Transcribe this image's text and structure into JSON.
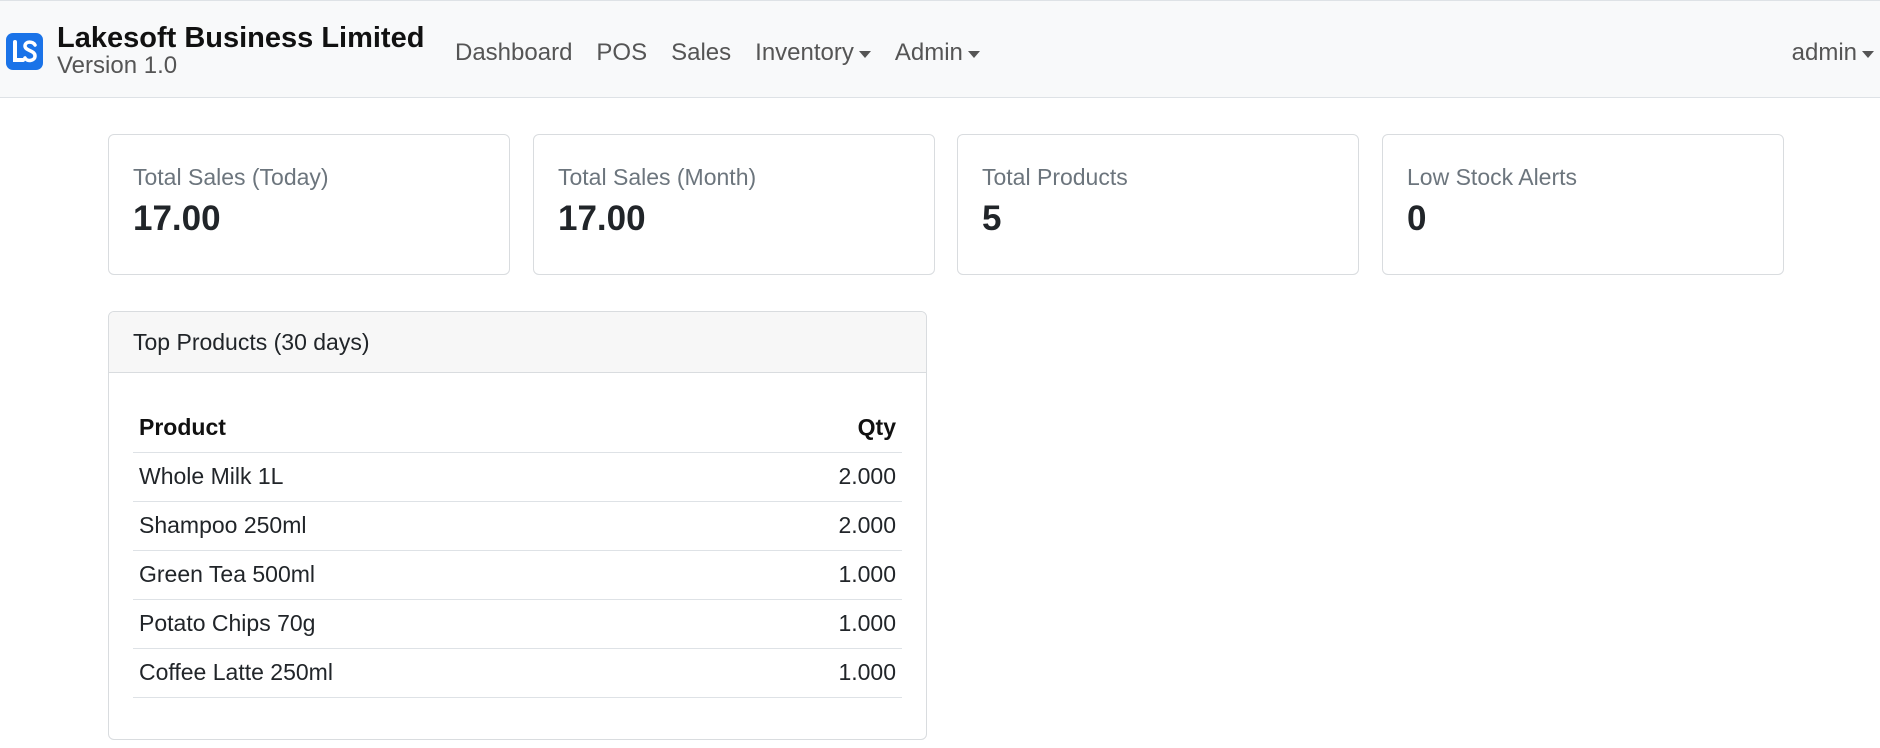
{
  "navbar": {
    "brand_title": "Lakesoft Business Limited",
    "brand_version": "Version 1.0",
    "logo_icon": "ls-logo-icon",
    "accent_color": "#1a73e8",
    "links": [
      {
        "label": "Dashboard",
        "dropdown": false
      },
      {
        "label": "POS",
        "dropdown": false
      },
      {
        "label": "Sales",
        "dropdown": false
      },
      {
        "label": "Inventory",
        "dropdown": true
      },
      {
        "label": "Admin",
        "dropdown": true
      }
    ],
    "user_label": "admin"
  },
  "stats": [
    {
      "label": "Total Sales (Today)",
      "value": "17.00"
    },
    {
      "label": "Total Sales (Month)",
      "value": "17.00"
    },
    {
      "label": "Total Products",
      "value": "5"
    },
    {
      "label": "Low Stock Alerts",
      "value": "0"
    }
  ],
  "top_products": {
    "title": "Top Products (30 days)",
    "columns": {
      "product": "Product",
      "qty": "Qty"
    },
    "rows": [
      {
        "product": "Whole Milk 1L",
        "qty": "2.000"
      },
      {
        "product": "Shampoo 250ml",
        "qty": "2.000"
      },
      {
        "product": "Green Tea 500ml",
        "qty": "1.000"
      },
      {
        "product": "Potato Chips 70g",
        "qty": "1.000"
      },
      {
        "product": "Coffee Latte 250ml",
        "qty": "1.000"
      }
    ]
  }
}
